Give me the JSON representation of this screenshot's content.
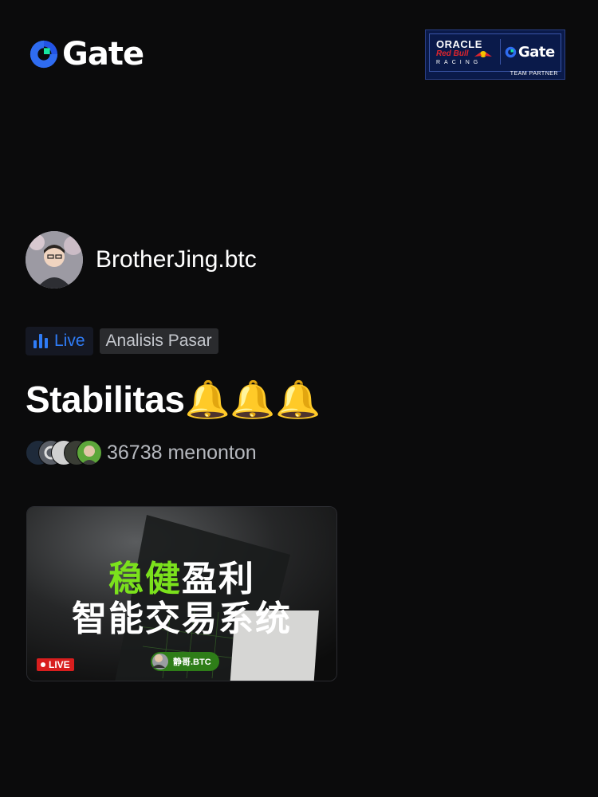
{
  "brand": {
    "logo_text": "Gate"
  },
  "partner_badge": {
    "oracle": "ORACLE",
    "redbull": "Red Bull",
    "racing": "RACING",
    "gate": "Gate",
    "team": "TEAM PARTNER"
  },
  "streamer": {
    "name": "BrotherJing.btc"
  },
  "tags": {
    "live": "Live",
    "category": "Analisis Pasar"
  },
  "stream": {
    "title": "Stabilitas🔔🔔🔔"
  },
  "viewers": {
    "count_text": "36738 menonton"
  },
  "thumbnail": {
    "line1_green": "稳健",
    "line1_white": "盈利",
    "line2": "智能交易系统",
    "live_badge": "LIVE",
    "host": "静哥.BTC"
  },
  "colors": {
    "background": "#0b0b0c",
    "accent_blue": "#2f7cf6",
    "thumbnail_green": "#7be11c",
    "live_red": "#d81e1e"
  },
  "icons": [
    "gate-logo-icon",
    "live-bars-icon",
    "live-dot-icon",
    "bell-icon"
  ]
}
